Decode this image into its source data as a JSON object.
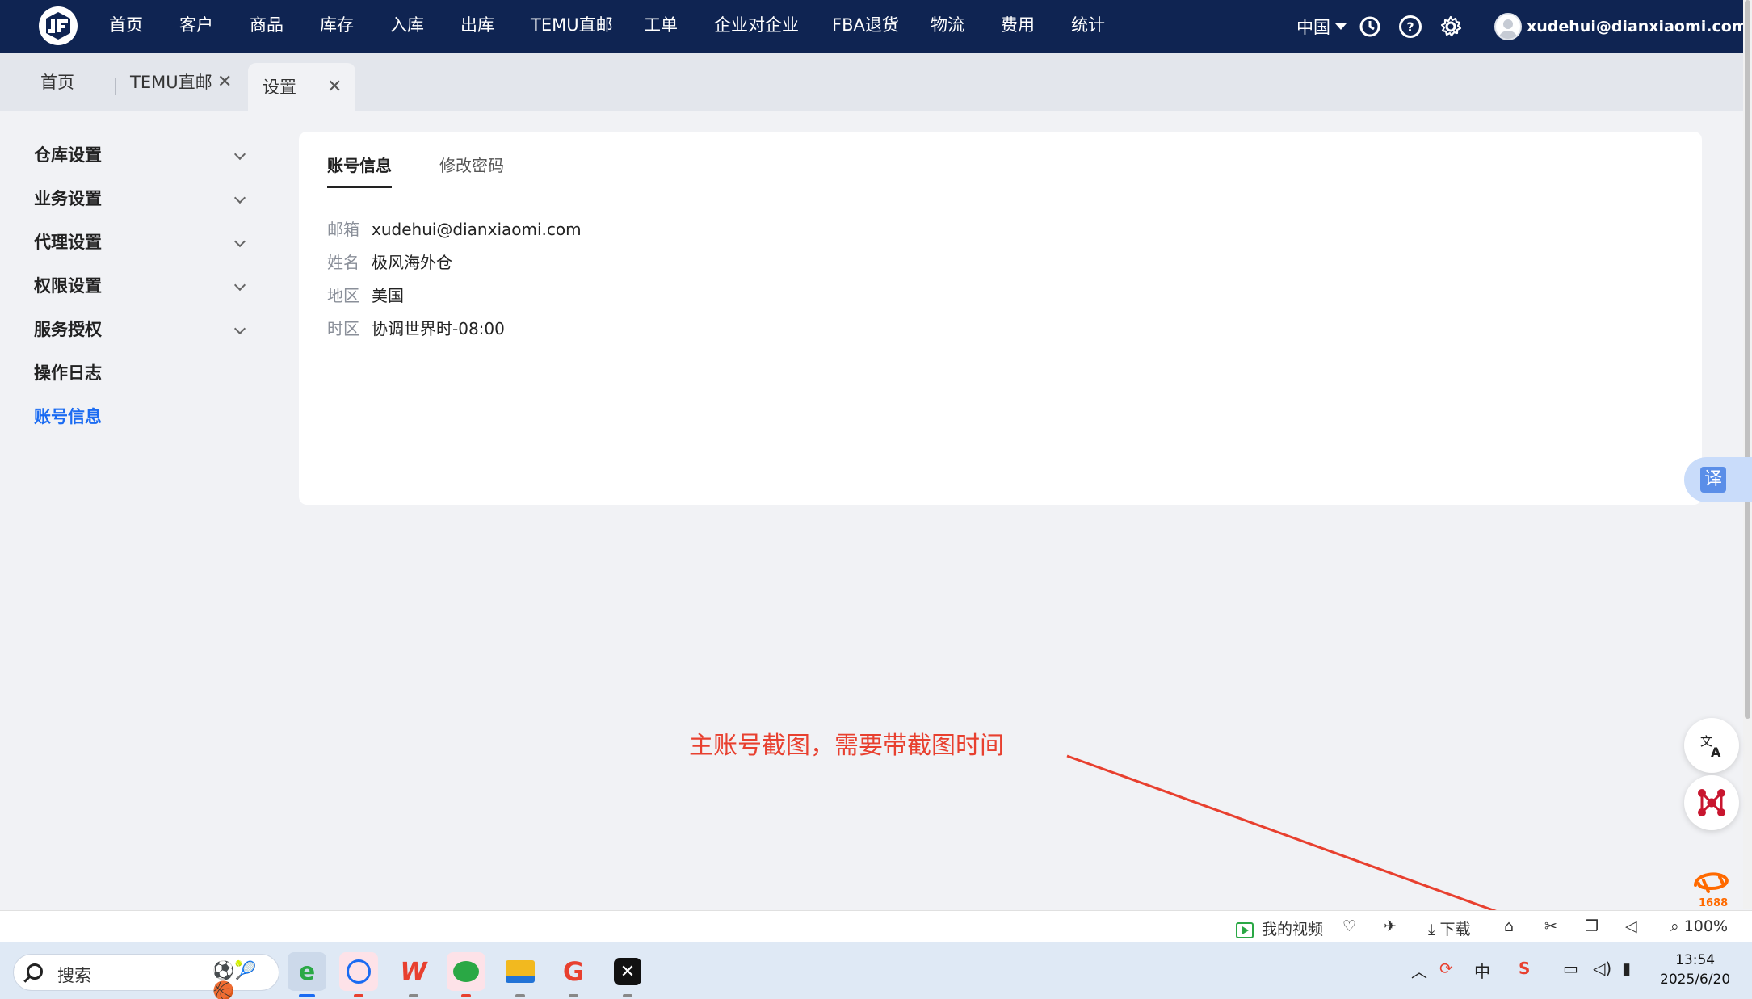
{
  "nav": {
    "items": [
      "首页",
      "客户",
      "商品",
      "库存",
      "入库",
      "出库",
      "TEMU直邮",
      "工单",
      "企业对企业",
      "FBA退货",
      "物流",
      "费用",
      "统计"
    ],
    "region": "中国",
    "user_email": "xudehui@dianxiaomi.com"
  },
  "tabs": [
    {
      "label": "首页",
      "closable": false
    },
    {
      "label": "TEMU直邮",
      "closable": true
    },
    {
      "label": "设置",
      "closable": true,
      "active": true
    }
  ],
  "tab_close_glyph": "✕",
  "sidebar": {
    "items": [
      {
        "label": "仓库设置",
        "expandable": true
      },
      {
        "label": "业务设置",
        "expandable": true
      },
      {
        "label": "代理设置",
        "expandable": true
      },
      {
        "label": "权限设置",
        "expandable": true
      },
      {
        "label": "服务授权",
        "expandable": true
      },
      {
        "label": "操作日志",
        "expandable": false
      },
      {
        "label": "账号信息",
        "expandable": false,
        "active": true
      }
    ]
  },
  "content": {
    "tabs": [
      "账号信息",
      "修改密码"
    ],
    "fields": [
      {
        "key": "邮箱",
        "value": "xudehui@dianxiaomi.com"
      },
      {
        "key": "姓名",
        "value": "极风海外仓"
      },
      {
        "key": "地区",
        "value": "美国"
      },
      {
        "key": "时区",
        "value": "协调世界时-08:00"
      }
    ]
  },
  "translate_tag": "译",
  "annotation": "主账号截图，需要带截图时间",
  "statusbar": {
    "my_video": "我的视频",
    "download": "下载",
    "zoom": "100%"
  },
  "taskbar": {
    "search_placeholder": "搜索",
    "ime": "中",
    "time": "13:54",
    "date": "2025/6/20",
    "side_badge": "1688"
  },
  "colors": {
    "nav_bg": "#0f2452",
    "accent": "#1a6bf2",
    "annotation": "#e8402f"
  }
}
